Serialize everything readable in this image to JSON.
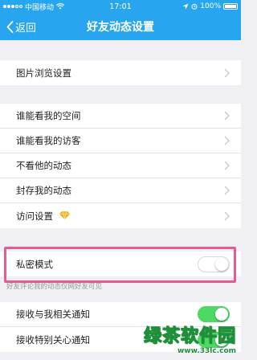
{
  "status_bar": {
    "carrier": "中国移动",
    "time": "17:01",
    "battery": "100%"
  },
  "nav": {
    "back_label": "返回",
    "title": "好友动态设置"
  },
  "sections": {
    "photo": [
      {
        "label": "图片浏览设置"
      }
    ],
    "privacy": [
      {
        "label": "谁能看我的空间"
      },
      {
        "label": "谁能看我的访客"
      },
      {
        "label": "不看他的动态"
      },
      {
        "label": "封存我的动态"
      },
      {
        "label": "访问设置",
        "icon": "diamond-icon"
      }
    ],
    "private_mode": {
      "label": "私密模式",
      "enabled": false
    },
    "private_mode_hint": "好友评论我的动态仅网好友可见",
    "notifications": [
      {
        "label": "接收与我相关通知",
        "enabled": true
      },
      {
        "label": "接收特别关心通知",
        "enabled": true
      }
    ]
  },
  "watermark": {
    "main": "绿茶软件园",
    "sub": "www.33lc.com"
  },
  "colors": {
    "accent": "#27a6ef",
    "highlight": "#e65b93",
    "toggle_on": "#4cd964"
  }
}
